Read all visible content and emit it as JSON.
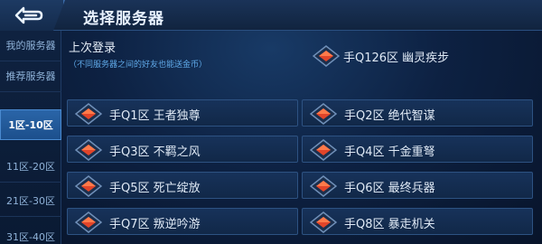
{
  "header": {
    "title": "选择服务器",
    "back_icon": "back-arrow-icon"
  },
  "sidebar": {
    "items": [
      {
        "label": "我的服务器",
        "active": false
      },
      {
        "label": "推荐服务器",
        "active": false
      },
      {
        "label": "1区-10区",
        "active": true
      },
      {
        "label": "11区-20区",
        "active": false
      },
      {
        "label": "21区-30区",
        "active": false
      },
      {
        "label": "31区-40区",
        "active": false
      }
    ]
  },
  "last_login": {
    "label": "上次登录",
    "note": "（不同服务器之间的好友也能送金币）",
    "server": "手Q126区 幽灵疾步"
  },
  "servers": [
    {
      "label": "手Q1区 王者独尊"
    },
    {
      "label": "手Q2区 绝代智谋"
    },
    {
      "label": "手Q3区 不羁之风"
    },
    {
      "label": "手Q4区 千金重弩"
    },
    {
      "label": "手Q5区 死亡绽放"
    },
    {
      "label": "手Q6区 最终兵器"
    },
    {
      "label": "手Q7区 叛逆吟游"
    },
    {
      "label": "手Q8区 暴走机关"
    }
  ],
  "colors": {
    "accent": "#3b6aa8",
    "active_tab": "#2a65a8",
    "status_icon": "#e2452a",
    "note_text": "#5fa9e8"
  }
}
